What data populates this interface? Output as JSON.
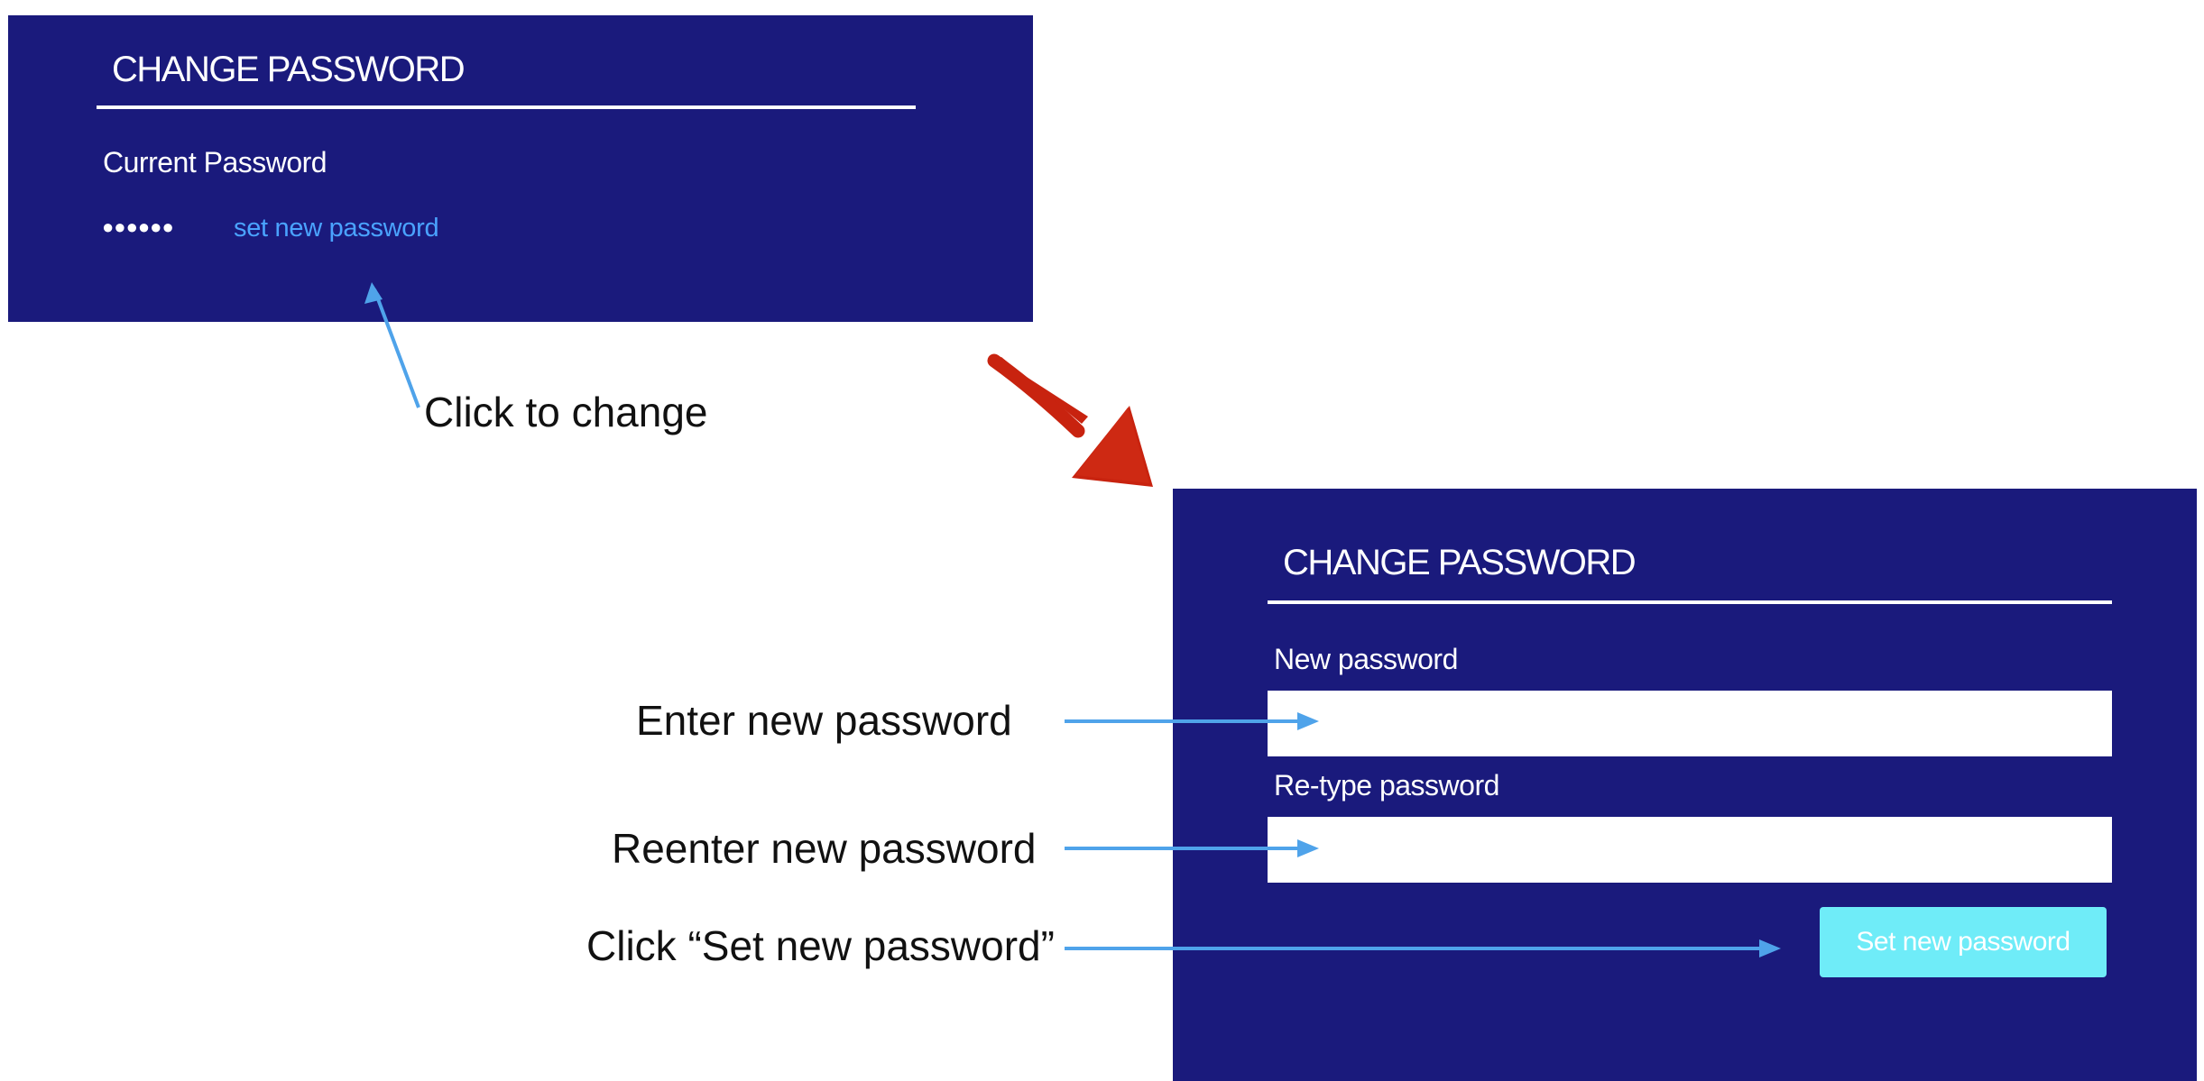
{
  "before_panel": {
    "title": "CHANGE PASSWORD",
    "current_password_label": "Current Password",
    "masked_password": "●●●●●●",
    "set_new_password_link": "set new password"
  },
  "after_panel": {
    "title": "CHANGE PASSWORD",
    "new_password_label": "New password",
    "new_password_value": "",
    "retype_password_label": "Re-type password",
    "retype_password_value": "",
    "submit_button_label": "Set new password"
  },
  "annotations": {
    "click_to_change": "Click to change",
    "enter_new_password": "Enter new password",
    "reenter_new_password": "Reenter new password",
    "click_set_new_password": "Click “Set new password”"
  },
  "colors": {
    "panel_background": "#1a1a7c",
    "link": "#4aa3ff",
    "button_background": "#6fecf8",
    "annotation_arrow": "#4fa3ea",
    "transition_arrow": "#c8230f"
  },
  "icons": {
    "transition": "red-diagonal-arrow-icon",
    "pointer": "blue-arrow-icon"
  }
}
